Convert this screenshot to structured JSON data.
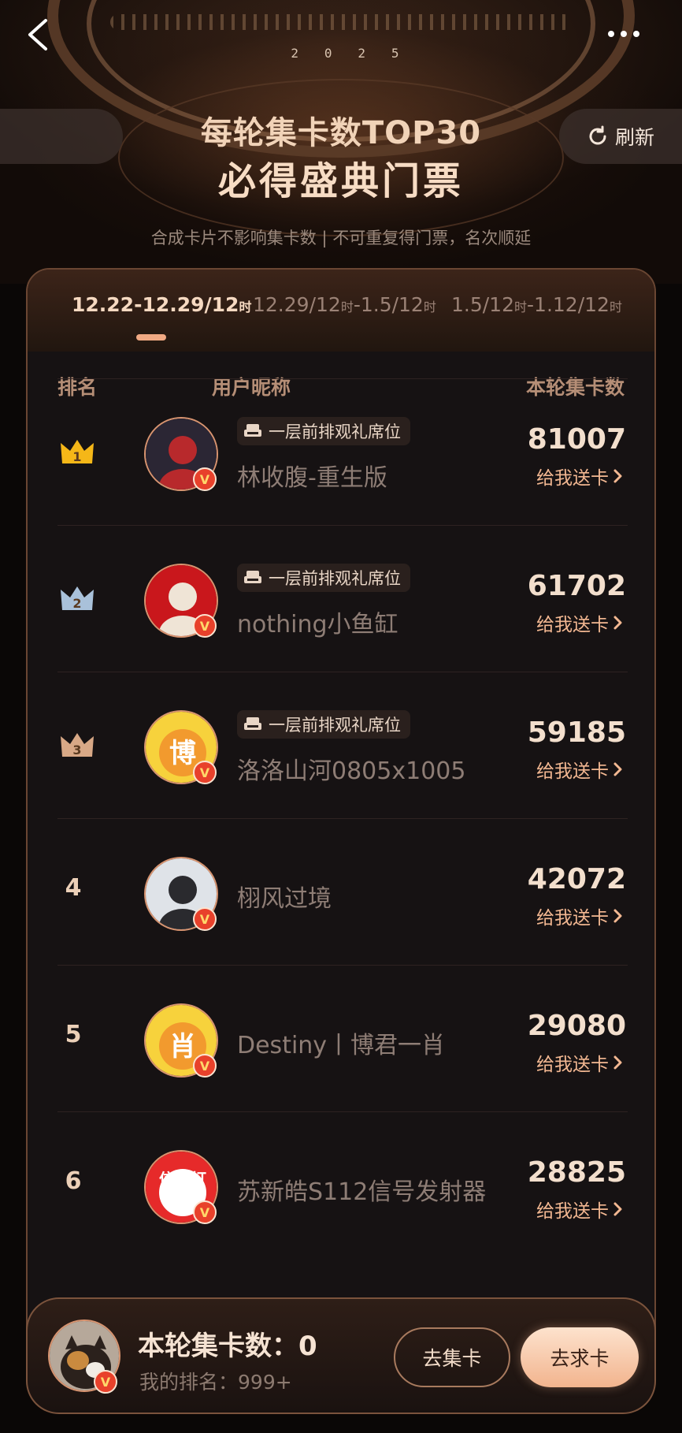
{
  "header": {
    "year_digits": [
      "2",
      "0",
      "2",
      "5"
    ],
    "title_line1": "每轮集卡数TOP30",
    "title_line2": "必得盛典门票",
    "subtitle": "合成卡片不影响集卡数 | 不可重复得门票，名次顺延",
    "refresh_label": "刷新",
    "icons": {
      "back": "chevron-left-icon",
      "more": "more-dots-icon",
      "refresh": "refresh-icon"
    }
  },
  "tabs": [
    {
      "main1": "12.22-12.29/12",
      "sub1": "时",
      "main2": "",
      "sub2": "",
      "active": true
    },
    {
      "main1": "12.29/12",
      "sub1": "时",
      "main2": "-1.5/12",
      "sub2": "时",
      "active": false
    },
    {
      "main1": "1.5/12",
      "sub1": "时",
      "main2": "-1.12/12",
      "sub2": "时",
      "active": false
    }
  ],
  "columns": {
    "rank": "排名",
    "nickname": "用户昵称",
    "count": "本轮集卡数"
  },
  "rows": [
    {
      "rank": "1",
      "crown": true,
      "crown_color": "#f5b718",
      "seat_tag": "一层前排观礼席位",
      "name": "林收腹-重生版",
      "count": "81007",
      "send_label": "给我送卡",
      "avatar_colors": [
        "#2b2634",
        "#b8292c"
      ]
    },
    {
      "rank": "2",
      "crown": true,
      "crown_color": "#a9c1da",
      "seat_tag": "一层前排观礼席位",
      "name": "nothing小鱼缸",
      "count": "61702",
      "send_label": "给我送卡",
      "avatar_colors": [
        "#c9171c",
        "#efe4d6"
      ]
    },
    {
      "rank": "3",
      "crown": true,
      "crown_color": "#d8a886",
      "seat_tag": "一层前排观礼席位",
      "name": "洛洛山河0805x1005",
      "count": "59185",
      "send_label": "给我送卡",
      "avatar_colors": [
        "#f7d23c",
        "#f29a2e"
      ],
      "avatar_text": "博"
    },
    {
      "rank": "4",
      "crown": false,
      "seat_tag": "",
      "name": "栩风过境",
      "count": "42072",
      "send_label": "给我送卡",
      "avatar_colors": [
        "#dfe3e8",
        "#2a2a2e"
      ]
    },
    {
      "rank": "5",
      "crown": false,
      "seat_tag": "",
      "name": "Destiny丨博君一肖",
      "count": "29080",
      "send_label": "给我送卡",
      "avatar_colors": [
        "#f7d23c",
        "#f29a2e"
      ],
      "avatar_text": "肖"
    },
    {
      "rank": "6",
      "crown": false,
      "seat_tag": "",
      "name": "苏新皓S112信号发射器",
      "count": "28825",
      "send_label": "给我送卡",
      "avatar_colors": [
        "#e62a2a",
        "#ffffff"
      ],
      "avatar_text": "信号灯卡送我"
    }
  ],
  "footer": {
    "my_count_label": "本轮集卡数：",
    "my_count_value": "0",
    "my_rank_label": "我的排名：",
    "my_rank_value": "999+",
    "collect_label": "去集卡",
    "request_label": "去求卡"
  },
  "colors": {
    "accent": "#f3b892",
    "badge_red": "#e8412b",
    "card_bg": "#161213"
  }
}
